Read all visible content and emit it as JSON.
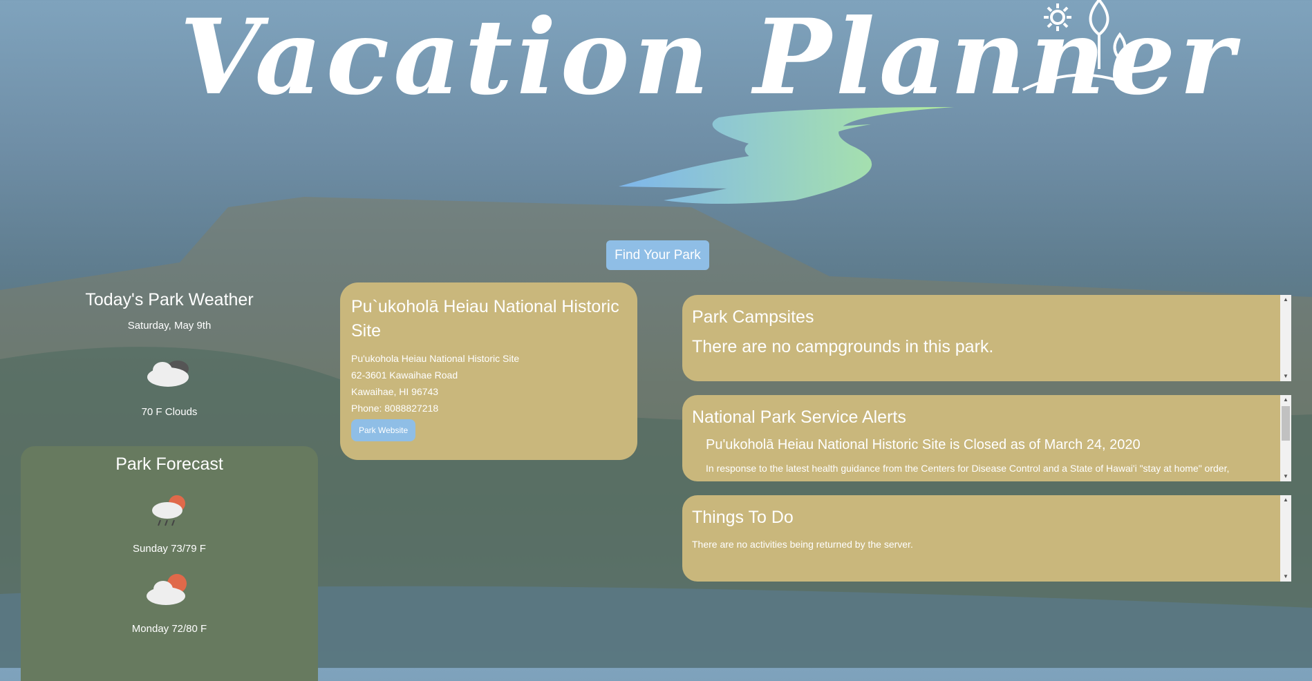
{
  "app": {
    "title": "Vacation Planner"
  },
  "header": {
    "find_button": "Find Your Park"
  },
  "weather": {
    "heading": "Today's Park Weather",
    "date": "Saturday, May 9th",
    "current": "70 F Clouds",
    "icon": "cloud-icon"
  },
  "forecast": {
    "heading": "Park Forecast",
    "days": [
      {
        "label": "Sunday 73/79 F",
        "icon": "rain-sun-icon"
      },
      {
        "label": "Monday 72/80 F",
        "icon": "cloud-sun-icon"
      }
    ]
  },
  "park": {
    "name": "Pu`ukoholā Heiau National Historic Site",
    "address_name": "Pu'ukohola Heiau National Historic Site",
    "street": "62-3601 Kawaihae Road",
    "city": "Kawaihae, HI 96743",
    "phone": "Phone: 8088827218",
    "website_button": "Park Website"
  },
  "campsites": {
    "heading": "Park Campsites",
    "message": "There are no campgrounds in this park."
  },
  "alerts": {
    "heading": "National Park Service Alerts",
    "items": [
      {
        "title": "Pu'ukoholā Heiau National Historic Site is Closed as of March 24, 2020",
        "body": "In response to the latest health guidance from the Centers for Disease Control and a State of Hawai'i \"stay at home\" order,"
      }
    ]
  },
  "todo": {
    "heading": "Things To Do",
    "message": "There are no activities being returned by the server."
  },
  "colors": {
    "card": "#c9b77c",
    "forecast_panel": "#677a5f",
    "button": "#8fbee6"
  }
}
